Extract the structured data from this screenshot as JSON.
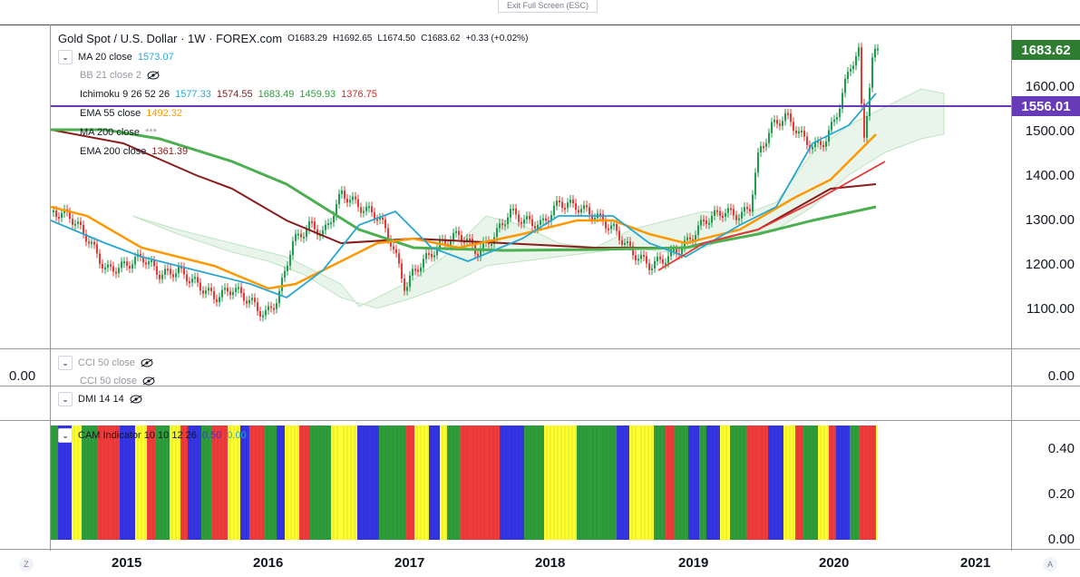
{
  "toolbar": {
    "exit_fullscreen": "Exit Full Screen (ESC)"
  },
  "header": {
    "symbol": "Gold Spot / U.S. Dollar · 1W · FOREX.com",
    "open": "O1683.29",
    "high": "H1692.65",
    "low": "L1674.50",
    "close": "C1683.62",
    "change": "+0.33 (+0.02%)"
  },
  "indicators": [
    {
      "label": "MA 20 close",
      "value": "1573.07",
      "value_color": "#2aa8d6",
      "hidden": false
    },
    {
      "label": "BB 21 close 2",
      "value": "",
      "value_color": "#999",
      "hidden": true
    },
    {
      "label": "Ichimoku 9 26 52 26",
      "values": [
        "1577.33",
        "1574.55",
        "1683.49",
        "1459.93",
        "1376.75"
      ],
      "value_colors": [
        "#2aa8d6",
        "#8b1a1a",
        "#2e9e3c",
        "#2e9e3c",
        "#d62a2a"
      ]
    },
    {
      "label": "EMA 55 close",
      "value": "1492.32",
      "value_color": "#ff9800"
    },
    {
      "label": "MA 200 close",
      "value": "***",
      "value_color": "#999"
    },
    {
      "label": "EMA 200 close",
      "value": "1361.39",
      "value_color": "#8b1a1a"
    }
  ],
  "price_axis": {
    "ticks": [
      "1600.00",
      "1500.00",
      "1400.00",
      "1300.00",
      "1200.00",
      "1100.00"
    ],
    "last_price": "1683.62",
    "hline_price": "1556.01",
    "last_color": "#2e7d32",
    "hline_color": "#673ab7"
  },
  "cci_pane": {
    "labels": [
      "CCI 50 close",
      "CCI 50 close"
    ],
    "zero_left": "0.00",
    "zero_right": "0.00"
  },
  "dmi_pane": {
    "label": "DMI 14 14"
  },
  "cam_pane": {
    "label": "CAM Indicator 10 10 12 26",
    "v1": "0.50",
    "v2": "0.00",
    "ticks": [
      "0.40",
      "0.20",
      "0.00"
    ],
    "colors": {
      "green": "#2e9e3c",
      "blue": "#3535e6",
      "red": "#f23c3c",
      "yellow": "#ffff2e"
    }
  },
  "time_axis": {
    "labels": [
      "2015",
      "2016",
      "2017",
      "2018",
      "2019",
      "2020",
      "2021"
    ]
  },
  "corners": {
    "left": "Z",
    "right": "A"
  }
}
